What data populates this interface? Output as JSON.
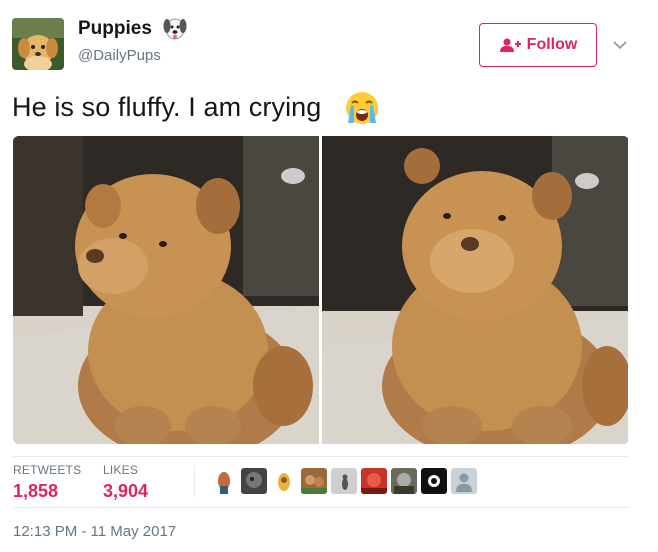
{
  "user": {
    "display_name": "Puppies",
    "handle": "@DailyPups",
    "avatar_text": "Puppies",
    "name_emoji": "dog-face-icon"
  },
  "follow_button": {
    "label": "Follow",
    "icon": "add-user-icon"
  },
  "menu_caret": "chevron-down-icon",
  "tweet": {
    "text": "He is so fluffy. I am crying",
    "emoji": "loudly-crying-face-icon"
  },
  "media": {
    "photos": [
      "fluffy-chow-puppy-photo-1",
      "fluffy-chow-puppy-photo-2"
    ]
  },
  "stats": {
    "retweets_label": "RETWEETS",
    "retweets_value": "1,858",
    "likes_label": "LIKES",
    "likes_value": "3,904"
  },
  "liker_avatars": [
    "liker-1",
    "liker-2",
    "liker-3",
    "liker-4",
    "liker-5",
    "liker-6",
    "liker-7",
    "liker-8",
    "liker-9",
    "liker-10"
  ],
  "timestamp": "12:13 PM - 11 May 2017",
  "colors": {
    "accent": "#e0245e",
    "muted": "#657786",
    "text": "#14171a",
    "divider": "#e6ecf0"
  }
}
